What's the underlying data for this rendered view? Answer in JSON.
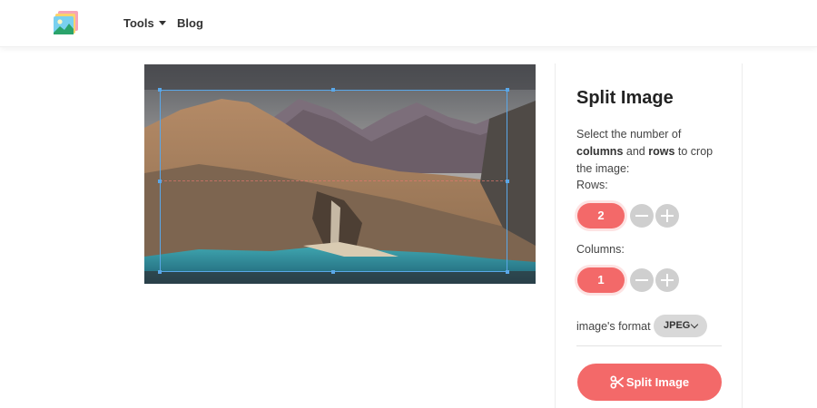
{
  "nav": {
    "tools_label": "Tools",
    "blog_label": "Blog"
  },
  "panel": {
    "title": "Split Image",
    "description_prefix": "Select the number of",
    "columns_word": "columns",
    "and_word": "and",
    "rows_word": "rows",
    "description_suffix": "to crop the image:",
    "rows_label": "Rows:",
    "rows_value": "2",
    "columns_label": "Columns:",
    "columns_value": "1",
    "format_label": "image's format",
    "format_value": "JPEG",
    "split_button_label": "Split Image"
  },
  "icons": {
    "logo": "image-stack-icon",
    "tools_caret": "caret-down-icon",
    "minus": "minus-icon",
    "plus": "plus-icon",
    "format_chevron": "chevron-down-icon",
    "split": "scissors-icon"
  },
  "colors": {
    "accent": "#f36969",
    "crop_outline": "#5aa7e8",
    "counter_button": "#cfcfcf",
    "select_bg": "#d8d8d8"
  }
}
